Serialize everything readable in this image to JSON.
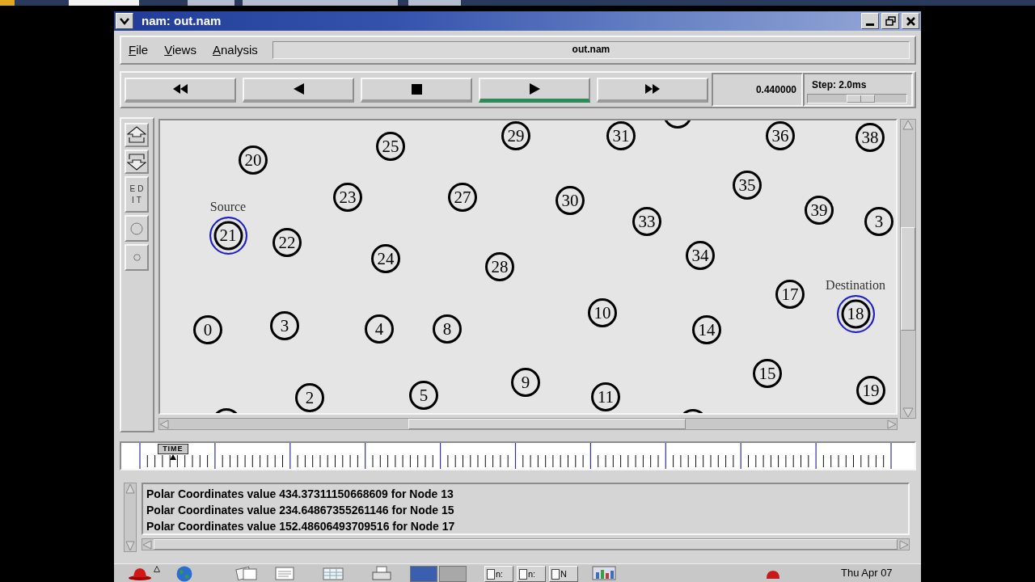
{
  "top_panel": {
    "tasks": [
      {
        "selected": true
      },
      {
        "selected": false
      },
      {
        "selected": false
      },
      {
        "selected": false
      }
    ]
  },
  "window": {
    "title": "nam: out.nam"
  },
  "menu": [
    "File",
    "Views",
    "Analysis"
  ],
  "filename": "out.nam",
  "controls": [
    {
      "kind": "rewind",
      "selected": false
    },
    {
      "kind": "back",
      "selected": false
    },
    {
      "kind": "stop",
      "selected": false
    },
    {
      "kind": "play",
      "selected": true
    },
    {
      "kind": "fast_forward",
      "selected": false
    }
  ],
  "time_display": "0.440000",
  "step": {
    "label": "Step: 2.0ms",
    "level": 0.55
  },
  "toolbar": [
    {
      "kind": "zoom_in"
    },
    {
      "kind": "zoom_out"
    },
    {
      "kind": "text",
      "label": "EDIT"
    },
    {
      "kind": "large_circle"
    },
    {
      "kind": "small_circle"
    }
  ],
  "canvas": {
    "nodes": [
      {
        "label": "20",
        "highlighted": false
      },
      {
        "label": "25",
        "highlighted": false
      },
      {
        "label": "29",
        "highlighted": false
      },
      {
        "label": "31",
        "highlighted": false
      },
      {
        "highlighted": false
      },
      {
        "label": "36",
        "highlighted": false
      },
      {
        "label": "38",
        "highlighted": false
      },
      {
        "label": "21",
        "highlighted": true,
        "annotation": "Source"
      },
      {
        "label": "22",
        "highlighted": false
      },
      {
        "label": "23",
        "highlighted": false
      },
      {
        "label": "27",
        "highlighted": false
      },
      {
        "label": "30",
        "highlighted": false
      },
      {
        "label": "33",
        "highlighted": false
      },
      {
        "label": "35",
        "highlighted": false
      },
      {
        "label": "39",
        "highlighted": false
      },
      {
        "label": "3",
        "highlighted": false
      },
      {
        "label": "24",
        "highlighted": false
      },
      {
        "label": "28",
        "highlighted": false
      },
      {
        "label": "34",
        "highlighted": false
      },
      {
        "label": "0",
        "highlighted": false
      },
      {
        "label": "3",
        "highlighted": false
      },
      {
        "label": "4",
        "highlighted": false
      },
      {
        "label": "8",
        "highlighted": false
      },
      {
        "label": "10",
        "highlighted": false
      },
      {
        "label": "14",
        "highlighted": false
      },
      {
        "label": "17",
        "highlighted": false
      },
      {
        "label": "18",
        "highlighted": true,
        "annotation": "Destination"
      },
      {
        "highlighted": false
      },
      {
        "label": "2",
        "highlighted": false
      },
      {
        "label": "5",
        "highlighted": false
      },
      {
        "label": "9",
        "highlighted": false
      },
      {
        "label": "11",
        "highlighted": false
      },
      {
        "highlighted": false
      },
      {
        "label": "15",
        "highlighted": false
      },
      {
        "label": "19",
        "highlighted": false
      }
    ]
  },
  "timeline": {
    "marker": "TIME",
    "level": 0.044
  },
  "log": {
    "lines": [
      "Polar Coordinates value 434.37311150668609 for Node 13",
      "Polar Coordinates value 234.64867355261146 for Node 15",
      "Polar Coordinates value 152.48606493709516 for Node 17"
    ]
  },
  "bottom_panel": {
    "launchers": [
      {
        "kind": "redhat"
      },
      {
        "kind": "menu_arrow"
      },
      {
        "kind": "globe"
      },
      {
        "kind": "papers"
      },
      {
        "kind": "notepad"
      },
      {
        "kind": "spreadsheet"
      },
      {
        "kind": "printer"
      }
    ],
    "workspaces": [
      {
        "selected": true
      },
      {
        "selected": false
      }
    ],
    "tasks": [
      "n:",
      "n:",
      "N"
    ],
    "applets": [
      {
        "kind": "chart"
      },
      {
        "kind": "tray"
      }
    ],
    "clock": "Thu Apr 07"
  }
}
